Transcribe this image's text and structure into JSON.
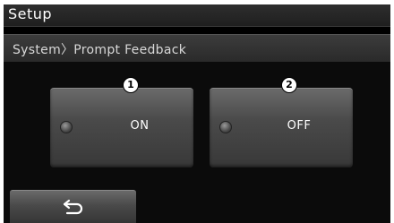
{
  "header": {
    "title": "Setup"
  },
  "breadcrumb": {
    "text": "System〉Prompt Feedback"
  },
  "options": [
    {
      "label": "ON",
      "callout": "1",
      "selected": false
    },
    {
      "label": "OFF",
      "callout": "2",
      "selected": false
    }
  ],
  "footer": {
    "back_icon": "back-arrow-icon"
  }
}
